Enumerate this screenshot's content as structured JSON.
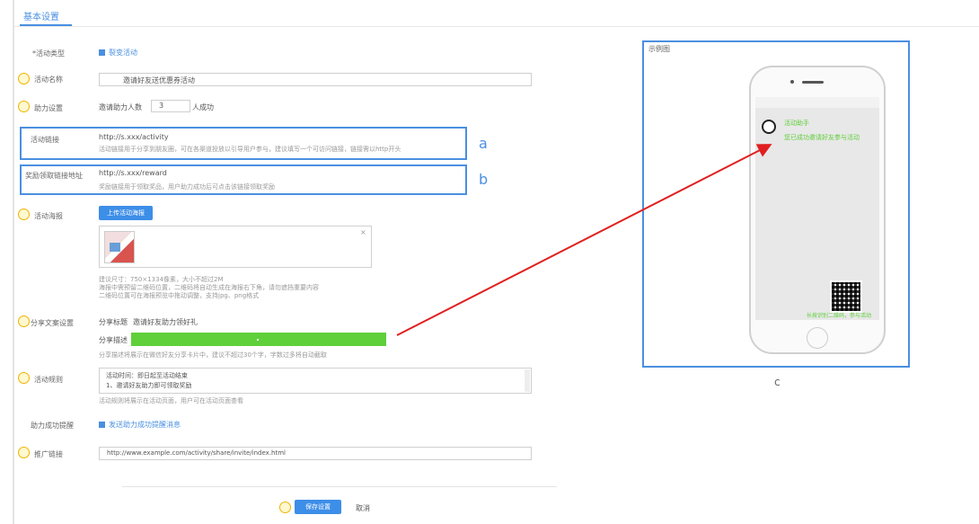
{
  "header": {
    "tab_label": "基本设置"
  },
  "form": {
    "row1": {
      "label": "*活动类型",
      "value": "裂变活动"
    },
    "row2": {
      "label": "活动名称",
      "value": "邀请好友送优惠券活动"
    },
    "row3": {
      "label": "助力设置",
      "prefix": "邀请助力人数",
      "count": "3",
      "suffix": "人成功"
    },
    "box_a": {
      "label": "活动链接",
      "url": "http://s.xxx/activity",
      "hint": "活动链接用于分享到朋友圈，可在各渠道投放以引导用户参与，建议填写一个可访问链接，链接需以http开头"
    },
    "box_b": {
      "label": "奖励领取链接地址",
      "url": "http://s.xxx/reward",
      "hint": "奖励链接用于领取奖品，用户助力成功后可点击该链接领取奖励"
    },
    "poster": {
      "label": "活动海报",
      "button": "上传活动海报",
      "hint1": "建议尺寸：750×1334像素，大小不超过2M",
      "hint2": "海报中需预留二维码位置，二维码将自动生成在海报右下角，请勿遮挡重要内容",
      "hint3": "二维码位置可在海报预览中拖动调整，支持jpg、png格式"
    },
    "share": {
      "label": "分享文案设置",
      "sublabel1": "分享标题",
      "title_value": "邀请好友助力领好礼",
      "sublabel2": "分享描述",
      "hint": "分享描述将展示在微信好友分享卡片中，建议不超过30个字，字数过多将自动截取"
    },
    "rules": {
      "label": "活动规则",
      "line1": "活动时间：即日起至活动结束",
      "line2": "1、邀请好友助力即可领取奖励",
      "hint": "活动规则将展示在活动页面，用户可在活动页面查看"
    },
    "notify": {
      "label": "助力成功提醒",
      "value": "发送助力成功提醒消息"
    },
    "link": {
      "label": "推广链接",
      "value": "http://www.example.com/activity/share/invite/index.html"
    }
  },
  "footer": {
    "save": "保存设置",
    "cancel": "取消"
  },
  "preview": {
    "label": "示例图",
    "msg_name": "活动助手",
    "msg_text": "您已成功邀请好友参与活动",
    "bottom_text": "长按识别二维码，参与活动"
  },
  "annotations": {
    "a": "a",
    "b": "b",
    "c": "c"
  },
  "colors": {
    "accent": "#4a8fe0",
    "green": "#5fcf3a",
    "arrow": "#e02020"
  }
}
